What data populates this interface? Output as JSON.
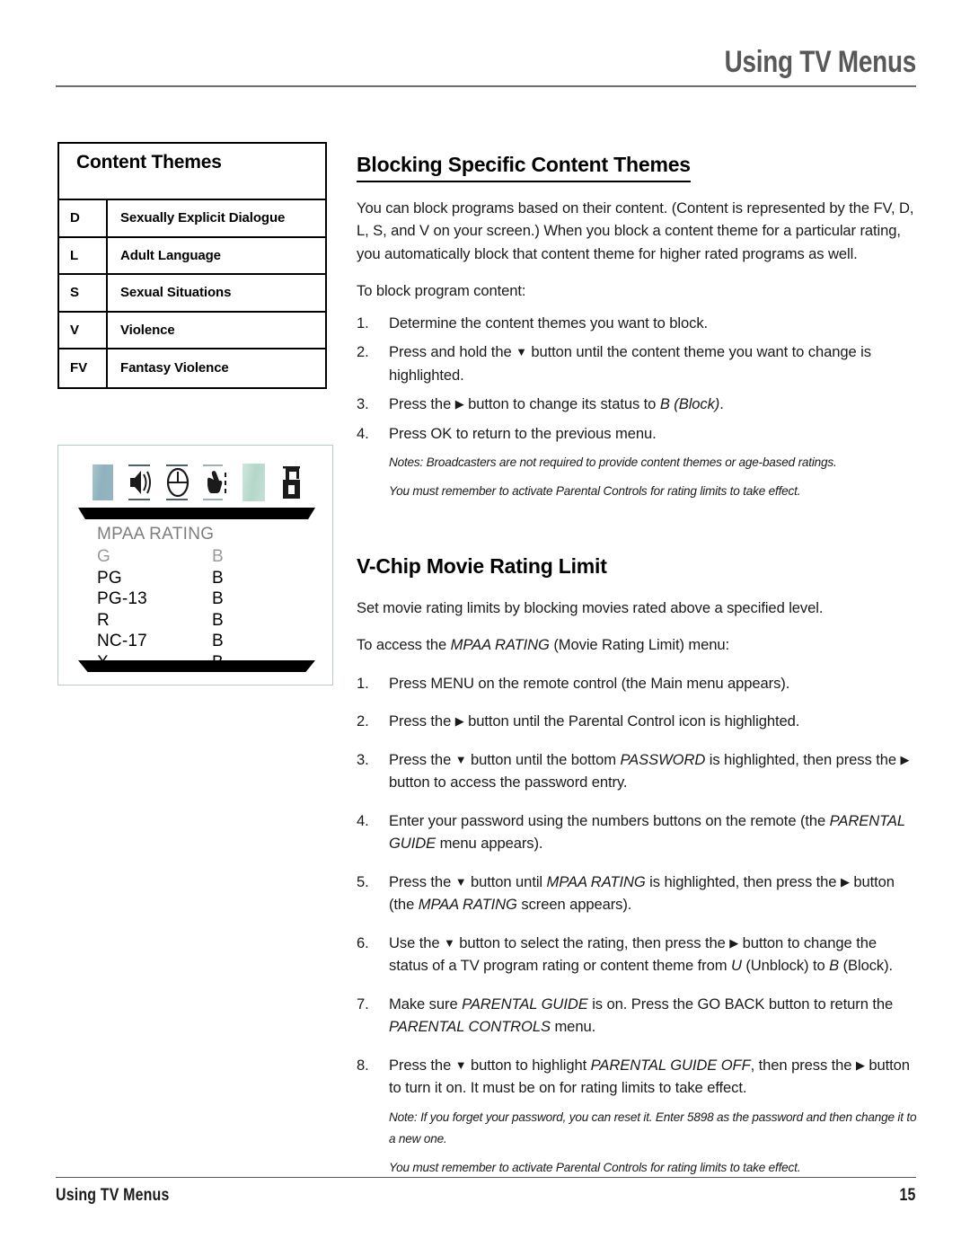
{
  "header": {
    "title": "Using TV Menus"
  },
  "content_themes_table": {
    "title": "Content Themes",
    "rows": [
      {
        "code": "D",
        "label": "Sexually Explicit Dialogue"
      },
      {
        "code": "L",
        "label": "Adult Language"
      },
      {
        "code": "S",
        "label": "Sexual Situations"
      },
      {
        "code": "V",
        "label": "Violence"
      },
      {
        "code": "FV",
        "label": "Fantasy Violence"
      }
    ]
  },
  "osd_figure": {
    "icons": [
      "picture-swatch-icon",
      "speaker-icon",
      "clock-icon",
      "hand-pointer-icon",
      "channel-swatch-icon",
      "padlock-icon"
    ],
    "heading": "MPAA RATING",
    "rows": [
      {
        "rating": "G",
        "status": "B",
        "dim": true
      },
      {
        "rating": "PG",
        "status": "B",
        "dim": false
      },
      {
        "rating": "PG-13",
        "status": "B",
        "dim": false
      },
      {
        "rating": "R",
        "status": "B",
        "dim": false
      },
      {
        "rating": "NC-17",
        "status": "B",
        "dim": false
      },
      {
        "rating": "X",
        "status": "B",
        "dim": false
      }
    ]
  },
  "section_blocking": {
    "title": "Blocking Specific Content Themes",
    "intro": "You can block programs based on their content. (Content is represented by the FV, D, L, S, and V on your screen.) When you block a content theme for a particular rating, you automatically block that content theme for higher rated programs as well.",
    "lead_in": "To block program content:",
    "steps": [
      {
        "num": "1.",
        "html": "Determine the content themes you want to block."
      },
      {
        "num": "2.",
        "html": "Press and hold the <span class=\"arrow-d\">▼</span> button until the content theme you want to change is highlighted."
      },
      {
        "num": "3.",
        "html": "Press the <span class=\"arrow-r\">▶</span> button to change its status to <i class=\"it\">B (Block)</i>."
      },
      {
        "num": "4.",
        "html": "Press OK to return to the previous menu."
      }
    ],
    "notes": [
      "Notes: Broadcasters are not required to provide content themes or age-based ratings.",
      "You must remember to activate Parental Controls for rating limits to take effect."
    ]
  },
  "section_vchip": {
    "title": "V-Chip Movie Rating Limit",
    "intro": "Set movie rating limits by blocking movies rated above a specified level.",
    "lead_in_html": "To access the <i class=\"it\">MPAA RATING</i> (Movie Rating Limit) menu:",
    "steps": [
      {
        "num": "1.",
        "html": "Press MENU on the remote control (the Main menu appears)."
      },
      {
        "num": "2.",
        "html": "Press the <span class=\"arrow-r\">▶</span> button until the Parental Control icon is highlighted."
      },
      {
        "num": "3.",
        "html": "Press the <span class=\"arrow-d\">▼</span> button until the bottom <i class=\"it\">PASSWORD</i> is highlighted, then press the <span class=\"arrow-r\">▶</span> button to access the password entry."
      },
      {
        "num": "4.",
        "html": "Enter your password using the numbers buttons on the remote (the <i class=\"it\">PARENTAL GUIDE</i> menu appears)."
      },
      {
        "num": "5.",
        "html": "Press the <span class=\"arrow-d\">▼</span> button until <i class=\"it\">MPAA RATING</i> is highlighted, then press the <span class=\"arrow-r\">▶</span> button (the <i class=\"it\">MPAA RATING</i> screen appears)."
      },
      {
        "num": "6.",
        "html": "Use the <span class=\"arrow-d\">▼</span> button to select the rating, then press the <span class=\"arrow-r\">▶</span> button to change the status of a TV program rating or content theme from <i class=\"it\">U</i> (Unblock) to <i class=\"it\">B</i> (Block)."
      },
      {
        "num": "7.",
        "html": "Make sure <i class=\"it\">PARENTAL GUIDE</i> is on. Press the GO BACK button to return the <i class=\"it\">PARENTAL CONTROLS</i> menu."
      },
      {
        "num": "8.",
        "html": "Press the <span class=\"arrow-d\">▼</span> button to highlight <i class=\"it\">PARENTAL GUIDE OFF</i>, then press the <span class=\"arrow-r\">▶</span> button to turn it on. It must be on for rating limits to take effect."
      }
    ],
    "notes": [
      "Note: If you forget your password, you can reset it. Enter 5898 as the password and then change it to a new one.",
      "You must remember to activate Parental Controls for rating limits to take effect."
    ]
  },
  "footer": {
    "left": "Using TV Menus",
    "page_number": "15"
  },
  "colors": {
    "header_gray": "#585858",
    "picture_swatch": "#8fb2bd",
    "channel_swatch": "#b3d7c8",
    "osd_dim_text": "#9a9a9a",
    "rule": "#6d6d6d"
  }
}
